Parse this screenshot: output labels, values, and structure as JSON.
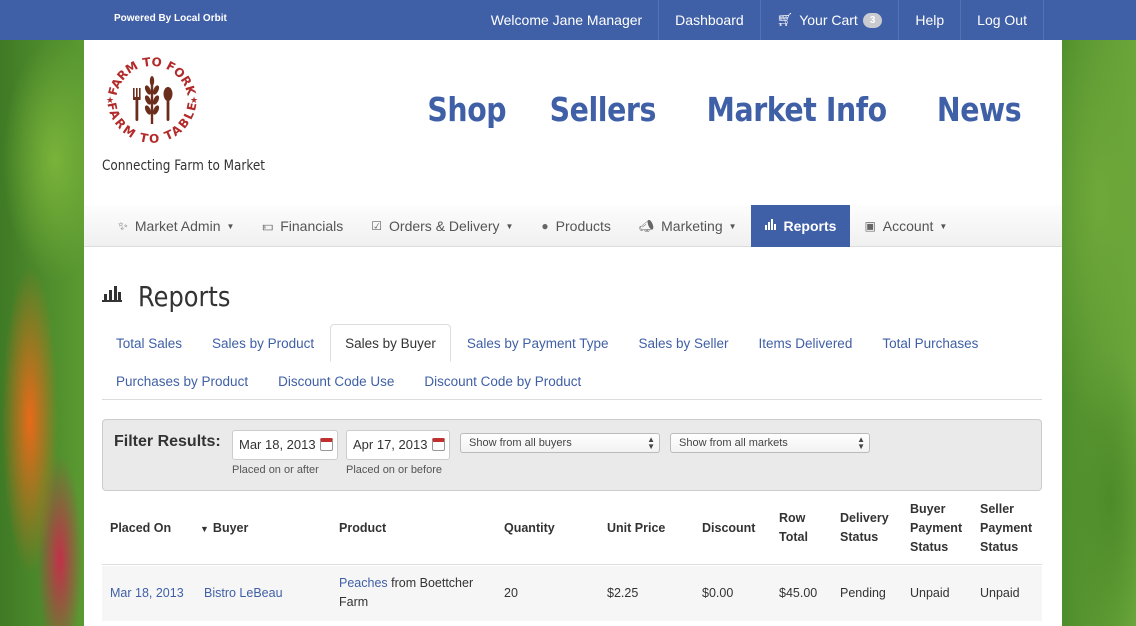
{
  "topbar": {
    "powered_by": "Powered By Local Orbit",
    "welcome": "Welcome Jane Manager",
    "dashboard": "Dashboard",
    "cart_label": "Your Cart",
    "cart_count": "3",
    "help": "Help",
    "logout": "Log Out"
  },
  "header": {
    "logo_text_top": "FARM TO FORK",
    "logo_text_bottom": "FARM TO TABLE",
    "tagline": "Connecting Farm to Market",
    "nav": [
      "Shop",
      "Sellers",
      "Market Info",
      "News"
    ]
  },
  "admin_nav": {
    "market_admin": "Market Admin",
    "financials": "Financials",
    "orders": "Orders & Delivery",
    "products": "Products",
    "marketing": "Marketing",
    "reports": "Reports",
    "account": "Account"
  },
  "page": {
    "title": "Reports"
  },
  "tabs": {
    "row1": [
      "Total Sales",
      "Sales by Product",
      "Sales by Buyer",
      "Sales by Payment Type",
      "Sales by Seller",
      "Items Delivered",
      "Total Purchases"
    ],
    "row2": [
      "Purchases by Product",
      "Discount Code Use",
      "Discount Code by Product"
    ],
    "active": "Sales by Buyer"
  },
  "filter": {
    "label": "Filter Results:",
    "start_date": "Mar 18, 2013",
    "start_hint": "Placed on or after",
    "end_date": "Apr 17, 2013",
    "end_hint": "Placed on or before",
    "buyers_select": "Show from all buyers",
    "markets_select": "Show from all markets"
  },
  "table": {
    "headers": {
      "placed_on": "Placed On",
      "buyer": "Buyer",
      "product": "Product",
      "quantity": "Quantity",
      "unit_price": "Unit Price",
      "discount": "Discount",
      "row_total_1": "Row",
      "row_total_2": "Total",
      "delivery_1": "Delivery",
      "delivery_2": "Status",
      "buyer_pay_1": "Buyer",
      "buyer_pay_2": "Payment",
      "buyer_pay_3": "Status",
      "seller_pay_1": "Seller",
      "seller_pay_2": "Payment",
      "seller_pay_3": "Status"
    },
    "rows": [
      {
        "placed_on": "Mar 18, 2013",
        "buyer": "Bistro LeBeau",
        "product_link": "Peaches",
        "product_rest_1": " from Boettcher",
        "product_rest_2": "Farm",
        "quantity": "20",
        "unit_price": "$2.25",
        "discount": "$0.00",
        "row_total": "$45.00",
        "delivery_status": "Pending",
        "buyer_payment": "Unpaid",
        "seller_payment": "Unpaid"
      }
    ]
  },
  "icons": {
    "cart": "cart-icon",
    "market_admin": "wand-icon",
    "financials": "money-icon",
    "orders": "clipboard-check-icon",
    "products": "apple-icon",
    "marketing": "megaphone-icon",
    "reports": "bar-chart-icon",
    "account": "address-book-icon",
    "calendar": "calendar-icon",
    "sort": "sort-down-icon"
  },
  "colors": {
    "brand_blue": "#3f5fa6",
    "logo_red": "#b22a2a",
    "logo_brown": "#6b2e1d"
  }
}
